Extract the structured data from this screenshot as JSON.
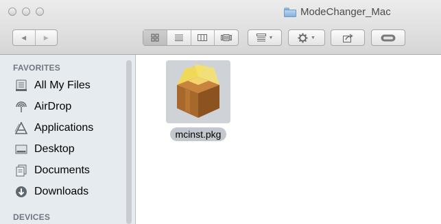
{
  "window": {
    "title": "ModeChanger_Mac"
  },
  "toolbar": {
    "back_glyph": "◀",
    "forward_glyph": "▶",
    "view_modes": [
      "icon-view",
      "list-view",
      "column-view",
      "coverflow-view"
    ],
    "active_view": "icon-view"
  },
  "sidebar": {
    "favorites_header": "FAVORITES",
    "items": [
      {
        "label": "All My Files",
        "icon": "all-files-icon"
      },
      {
        "label": "AirDrop",
        "icon": "airdrop-icon"
      },
      {
        "label": "Applications",
        "icon": "applications-icon"
      },
      {
        "label": "Desktop",
        "icon": "desktop-icon"
      },
      {
        "label": "Documents",
        "icon": "documents-icon"
      },
      {
        "label": "Downloads",
        "icon": "downloads-icon"
      }
    ],
    "devices_header": "DEVICES"
  },
  "content": {
    "files": [
      {
        "name": "mcinst.pkg",
        "icon": "package-icon",
        "selected": true
      }
    ]
  },
  "colors": {
    "sidebar_bg": "#e6ebf0",
    "selection_bg": "#c3c8ce",
    "toolbar_top": "#ececec",
    "toolbar_bottom": "#d6d6d6"
  }
}
